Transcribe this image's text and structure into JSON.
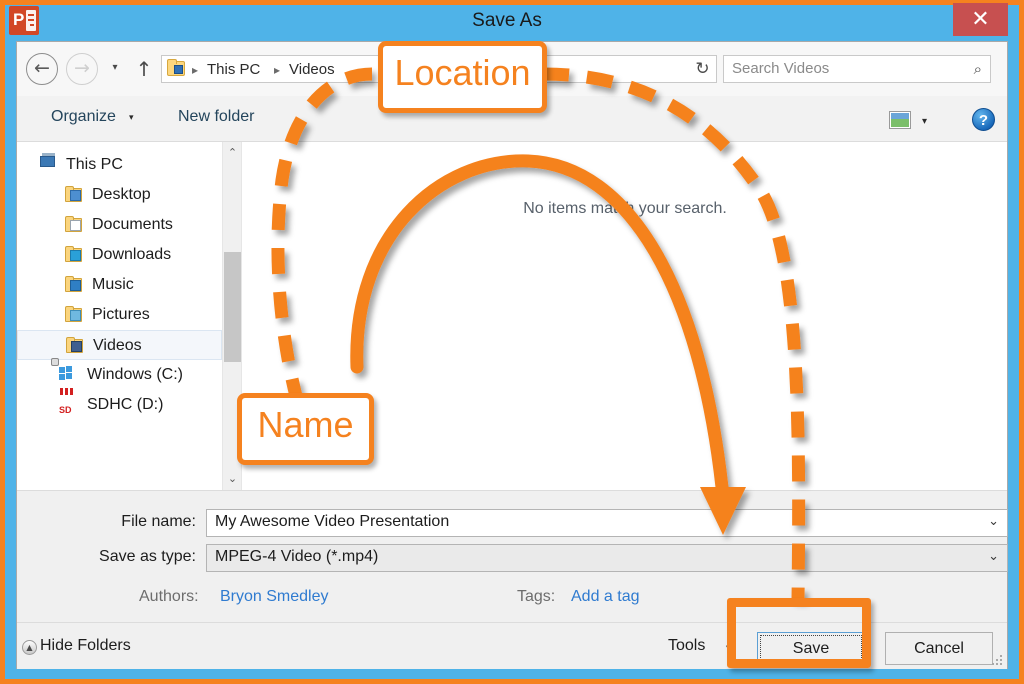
{
  "window": {
    "app_icon": "powerpoint-icon",
    "title": "Save As",
    "close_label": "✕",
    "accent_blue": "#4fb3e8",
    "annotation_orange": "#f5821f",
    "close_red": "#c75050"
  },
  "nav": {
    "back_icon": "←",
    "forward_icon": "→",
    "history_icon": "▾",
    "up_icon": "↑",
    "breadcrumb": [
      "This PC",
      "Videos"
    ],
    "separator": "▸",
    "address_chevron": "⌄",
    "refresh_icon": "↻"
  },
  "search": {
    "placeholder": "Search Videos",
    "icon": "search-icon",
    "glyph": "⌕"
  },
  "toolbar": {
    "organize_label": "Organize",
    "organize_caret": "▾",
    "new_folder_label": "New folder",
    "view_icon": "preview-pane-icon",
    "view_caret": "▾",
    "help_label": "?"
  },
  "sidebar": {
    "items": [
      {
        "label": "This PC",
        "icon": "computer-icon",
        "indent": 22,
        "selected": false
      },
      {
        "label": "Desktop",
        "icon": "folder-desktop-icon",
        "indent": 48,
        "selected": false
      },
      {
        "label": "Documents",
        "icon": "folder-documents-icon",
        "indent": 48,
        "selected": false
      },
      {
        "label": "Downloads",
        "icon": "folder-downloads-icon",
        "indent": 48,
        "selected": false
      },
      {
        "label": "Music",
        "icon": "folder-music-icon",
        "indent": 48,
        "selected": false
      },
      {
        "label": "Pictures",
        "icon": "folder-pictures-icon",
        "indent": 48,
        "selected": false
      },
      {
        "label": "Videos",
        "icon": "folder-videos-icon",
        "indent": 48,
        "selected": true
      },
      {
        "label": "Windows (C:)",
        "icon": "windows-drive-icon",
        "indent": 42,
        "selected": false
      },
      {
        "label": "SDHC (D:)",
        "icon": "sd-card-icon",
        "indent": 42,
        "selected": false
      }
    ],
    "scroll_up_icon": "⌃",
    "scroll_down_icon": "⌄"
  },
  "filelist": {
    "empty_message": "No items match your search."
  },
  "form": {
    "file_name_label": "File name:",
    "file_name_value": "My Awesome Video Presentation",
    "file_name_chevron": "⌄",
    "save_as_type_label": "Save as type:",
    "save_as_type_value": "MPEG-4 Video (*.mp4)",
    "save_as_type_chevron": "⌄",
    "authors_label": "Authors:",
    "authors_value": "Bryon Smedley",
    "tags_label": "Tags:",
    "tags_value": "Add a tag"
  },
  "footer": {
    "hide_folders_label": "Hide Folders",
    "hide_folders_icon": "▲",
    "tools_label": "Tools",
    "tools_caret": "▼",
    "save_label": "Save",
    "cancel_label": "Cancel"
  },
  "annotations": {
    "location_callout": "Location",
    "name_callout": "Name"
  }
}
